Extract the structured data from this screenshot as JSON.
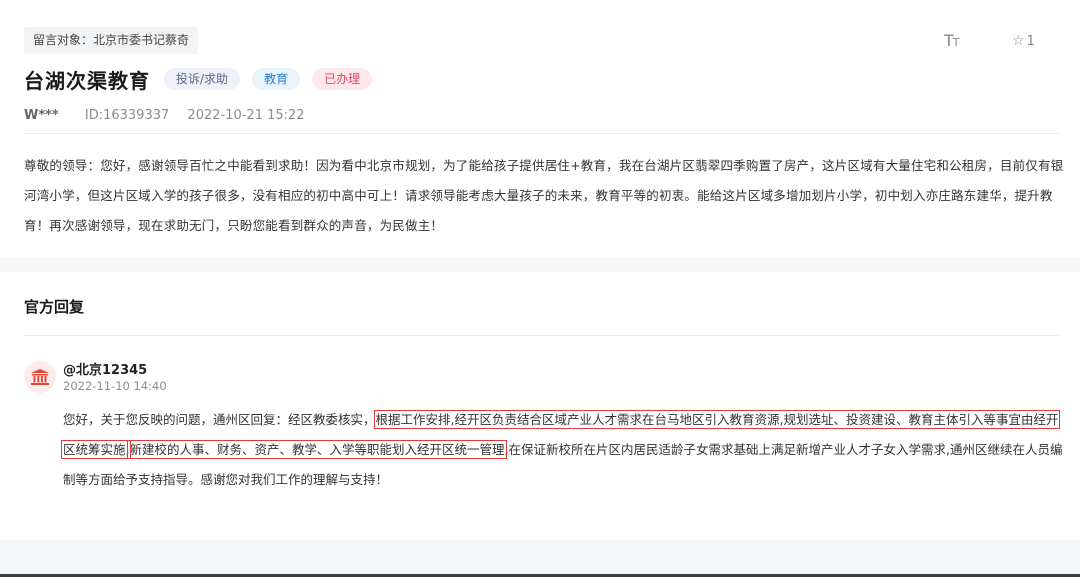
{
  "post": {
    "recipient_tag": "留言对象：北京市委书记蔡奇",
    "title": "台湖次渠教育",
    "badges": [
      "投诉/求助",
      "教育",
      "已办理"
    ],
    "user": "W***",
    "id_text": "ID:16339337",
    "date": "2022-10-21 15:22",
    "favorite_count": "1",
    "message": "尊敬的领导：您好，感谢领导百忙之中能看到求助！因为看中北京市规划，为了能给孩子提供居住+教育，我在台湖片区翡翠四季购置了房产，这片区域有大量住宅和公租房，目前仅有银河湾小学，但这片区域入学的孩子很多，没有相应的初中高中可上！请求领导能考虑大量孩子的未来，教育平等的初衷。能给这片区域多增加划片小学，初中划入亦庄路东建华，提升教育！再次感谢领导，现在求助无门，只盼您能看到群众的声音，为民做主！"
  },
  "reply": {
    "header": "官方回复",
    "replier": "@北京12345",
    "time": "2022-11-10 14:40",
    "body_part1": "您好，关于您反映的问题，通州区回复：经区教委核实，",
    "body_highlight1": "根据工作安排,经开区负责结合区域产业人才需求在台马地区引入教育资源,规划选址、投资建设、教育主体引入等事宜由经开区统筹实施,",
    "body_highlight2": "新建校的人事、财务、资产、教学、入学等职能划入经开区统一管理",
    "body_part2": ",在保证新校所在片区内居民适龄子女需求基础上满足新增产业人才子女入学需求,通州区继续在人员编制等方面给予支持指导。感谢您对我们工作的理解与支持！"
  },
  "icons": {
    "font_size": "font-size-icon",
    "favorite": "star-outline-icon",
    "avatar": "government-building-icon"
  },
  "colors": {
    "highlight_outline": "#e03a3a",
    "badge_status": "#e04a5f",
    "badge_category": "#2f7fc8"
  }
}
